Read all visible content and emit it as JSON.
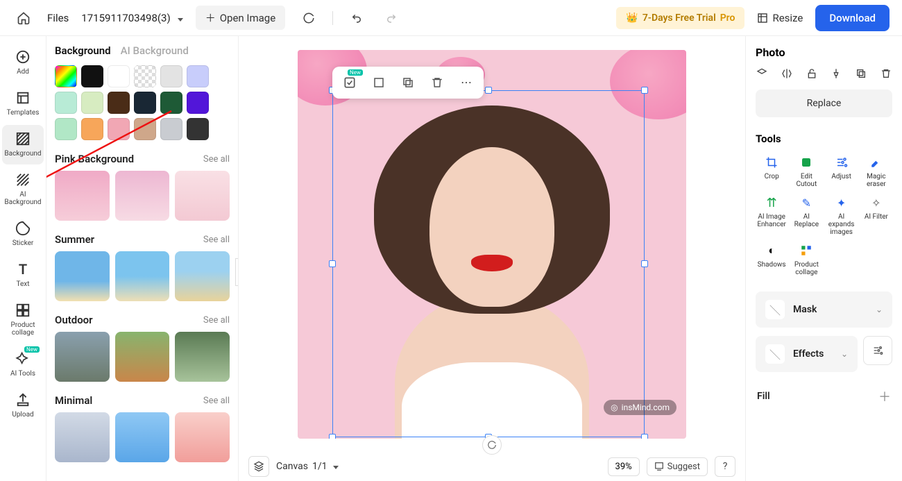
{
  "topbar": {
    "files_label": "Files",
    "doc_name": "1715911703498(3)",
    "open_image": "Open Image",
    "trial": "7-Days Free Trial",
    "pro": "Pro",
    "resize": "Resize",
    "download": "Download"
  },
  "left_rail": [
    {
      "id": "add",
      "label": "Add"
    },
    {
      "id": "templates",
      "label": "Templates"
    },
    {
      "id": "background",
      "label": "Background",
      "active": true
    },
    {
      "id": "ai-background",
      "label": "AI\nBackground"
    },
    {
      "id": "sticker",
      "label": "Sticker"
    },
    {
      "id": "text",
      "label": "Text"
    },
    {
      "id": "product-collage",
      "label": "Product\ncollage"
    },
    {
      "id": "ai-tools",
      "label": "AI Tools",
      "new": true
    },
    {
      "id": "upload",
      "label": "Upload"
    }
  ],
  "bg_panel": {
    "tab_active": "Background",
    "tab_inactive": "AI Background",
    "swatches": [
      "gradient",
      "#111111",
      "none",
      "transp",
      "#e3e3e3",
      "#c8cdfb",
      "#b8ebd6",
      "#d7ecc1",
      "#4a2c17",
      "#192734",
      "#1e5a36",
      "#5216d9",
      "#b1e7c6",
      "#f7a65a",
      "#f1a7b4",
      "#cfa78a",
      "#c9ccd1",
      "#333333"
    ],
    "sections": [
      {
        "title": "Pink Background",
        "see_all": "See all",
        "thumbs": [
          "#f3b8cf",
          "#efbfd6",
          "#f6d6de"
        ]
      },
      {
        "title": "Summer",
        "see_all": "See all",
        "thumbs": [
          "sky",
          "beach",
          "sand"
        ]
      },
      {
        "title": "Outdoor",
        "see_all": "See all",
        "thumbs": [
          "rock",
          "meadow",
          "trees"
        ]
      },
      {
        "title": "Minimal",
        "see_all": "See all",
        "thumbs": [
          "#b8c4d6",
          "#74b7ef",
          "#f5b3b0"
        ]
      }
    ]
  },
  "canvas": {
    "label_prefix": "Canvas",
    "page": "1/1",
    "zoom": "39%",
    "suggest": "Suggest",
    "help": "?",
    "watermark": "insMind.com"
  },
  "right_panel": {
    "title": "Photo",
    "replace": "Replace",
    "tools_title": "Tools",
    "tools": [
      {
        "id": "crop",
        "label": "Crop",
        "color": "#2563eb"
      },
      {
        "id": "edit-cutout",
        "label": "Edit\nCutout",
        "color": "#16a34a"
      },
      {
        "id": "adjust",
        "label": "Adjust",
        "color": "#2563eb"
      },
      {
        "id": "magic-eraser",
        "label": "Magic\neraser",
        "color": "#2563eb"
      },
      {
        "id": "ai-enhancer",
        "label": "AI Image\nEnhancer",
        "color": "#16a34a"
      },
      {
        "id": "ai-replace",
        "label": "AI\nReplace",
        "color": "#2563eb"
      },
      {
        "id": "ai-expand",
        "label": "AI\nexpands\nimages",
        "color": "#2563eb"
      },
      {
        "id": "ai-filter",
        "label": "AI Filter",
        "color": "#777"
      },
      {
        "id": "shadows",
        "label": "Shadows",
        "color": "#777"
      },
      {
        "id": "product-collage",
        "label": "Product\ncollage",
        "color": "#16a34a"
      }
    ],
    "mask": "Mask",
    "effects": "Effects",
    "fill": "Fill"
  }
}
